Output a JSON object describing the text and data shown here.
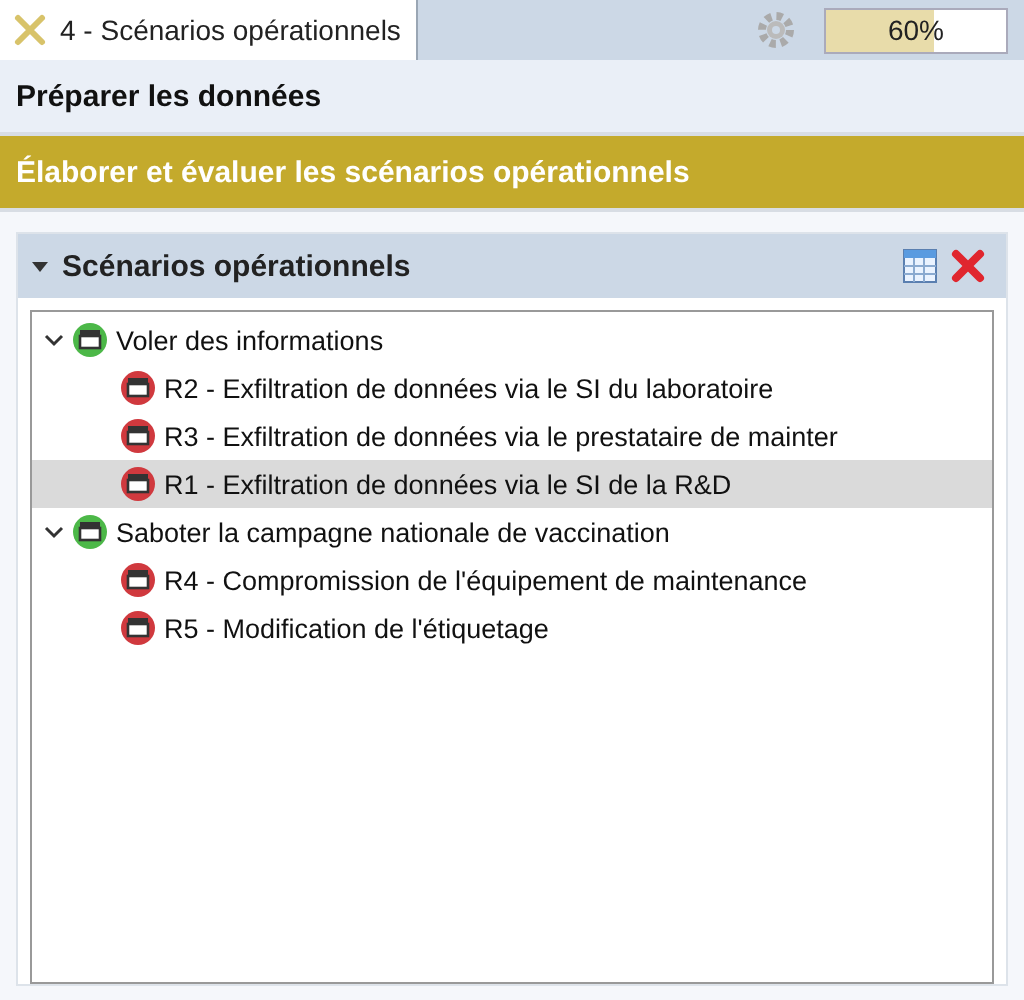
{
  "tab": {
    "label": "4 - Scénarios opérationnels",
    "selected": true
  },
  "progress": {
    "level": 0.6,
    "reading": "60%"
  },
  "steps": [
    {
      "label": "Préparer les données",
      "selected": false
    },
    {
      "label": "Élaborer et évaluer les scénarios opérationnels",
      "selected": true
    }
  ],
  "panel": {
    "title": "Scénarios opérationnels",
    "expanded": true
  },
  "tree": [
    {
      "label": "Voler des informations",
      "color": "#4cb848",
      "expanded": true,
      "selected": false,
      "children": [
        {
          "label": "R2 - Exfiltration de données via le SI du laboratoire",
          "color": "#d0393e",
          "selected": false
        },
        {
          "label": "R3 - Exfiltration de données via le prestataire de mainter",
          "color": "#d0393e",
          "selected": false
        },
        {
          "label": "R1 - Exfiltration de données via le SI de la R&D",
          "color": "#d0393e",
          "selected": true
        }
      ]
    },
    {
      "label": "Saboter la campagne nationale de vaccination",
      "color": "#4cb848",
      "expanded": true,
      "selected": false,
      "children": [
        {
          "label": "R4 - Compromission de l'équipement de maintenance",
          "color": "#d0393e",
          "selected": false
        },
        {
          "label": "R5 - Modification de l'étiquetage",
          "color": "#d0393e",
          "selected": false
        }
      ]
    }
  ]
}
